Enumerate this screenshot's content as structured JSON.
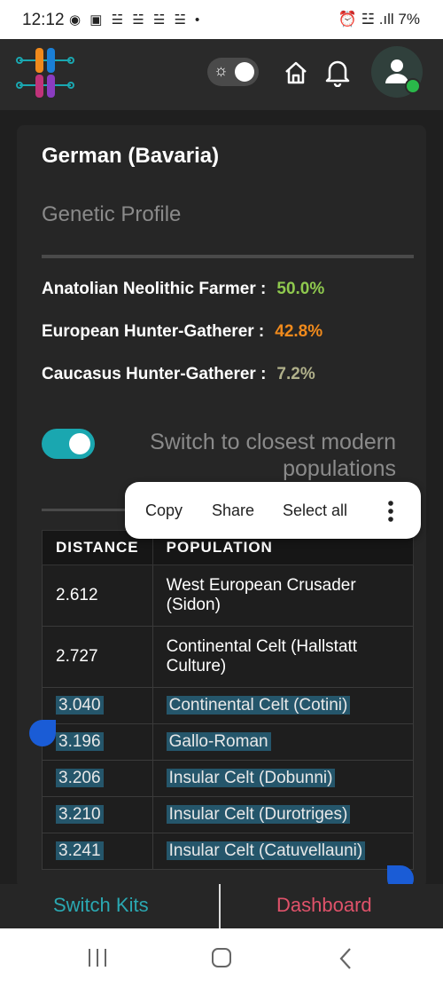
{
  "status_bar": {
    "time": "12:12",
    "notifications": "◉ ▣ ☱ ☱ ☱ ☱ •",
    "right": "⏰ ☳ .ıll 7%"
  },
  "header": {
    "theme_toggle_icon": "sun-icon",
    "home_icon": "home-icon",
    "bell_icon": "bell-icon",
    "avatar_status_color": "#2ab84a"
  },
  "card": {
    "title": "German (Bavaria)",
    "section_title": "Genetic Profile",
    "ancestry": [
      {
        "label": "Anatolian Neolithic Farmer :",
        "value": "50.0%",
        "color": "#8fc94e"
      },
      {
        "label": "European Hunter-Gatherer :",
        "value": "42.8%",
        "color": "#f08a1c"
      },
      {
        "label": "Caucasus Hunter-Gatherer :",
        "value": "7.2%",
        "color": "#b0b08a"
      }
    ],
    "switch_label": "Switch to closest modern populations",
    "table": {
      "headers": [
        "DISTANCE",
        "POPULATION"
      ],
      "rows": [
        {
          "distance": "2.612",
          "population": "West European Crusader (Sidon)"
        },
        {
          "distance": "2.727",
          "population": "Continental Celt (Hallstatt Culture)"
        },
        {
          "distance": "3.040",
          "population": "Continental Celt (Cotini)"
        },
        {
          "distance": "3.196",
          "population": "Gallo-Roman"
        },
        {
          "distance": "3.206",
          "population": "Insular Celt (Dobunni)"
        },
        {
          "distance": "3.210",
          "population": "Insular Celt (Durotriges)"
        },
        {
          "distance": "3.241",
          "population": "Insular Celt (Catuvellauni)"
        }
      ]
    }
  },
  "context_menu": {
    "copy": "Copy",
    "share": "Share",
    "select_all": "Select all",
    "more_icon": "more-vertical-icon"
  },
  "bottom_bar": {
    "switch_kits": "Switch Kits",
    "dashboard": "Dashboard"
  },
  "nav_bar": {
    "recents_icon": "recents-icon",
    "home_icon": "home-circle-icon",
    "back_icon": "back-icon"
  }
}
